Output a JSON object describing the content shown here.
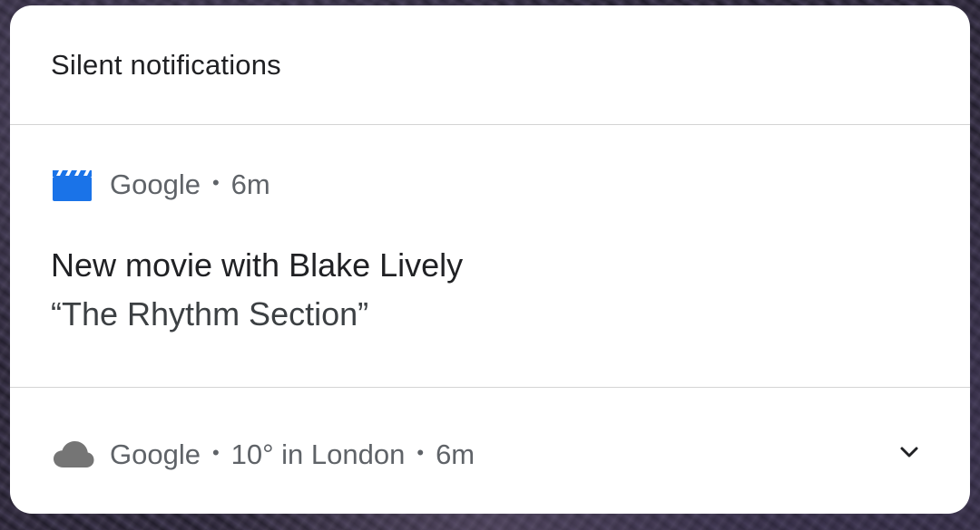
{
  "section": {
    "title": "Silent notifications"
  },
  "movie_notification": {
    "app_icon": "clapperboard-icon",
    "app_icon_color": "#1a73e8",
    "app_name": "Google",
    "separator": "•",
    "time": "6m",
    "title": "New movie with Blake Lively",
    "text": "“The Rhythm Section”"
  },
  "weather_notification": {
    "app_icon": "cloud-icon",
    "app_icon_color": "#757575",
    "app_name": "Google",
    "separator": "•",
    "summary": "10° in London",
    "separator2": "•",
    "time": "6m",
    "expand_icon": "chevron-down-icon"
  }
}
